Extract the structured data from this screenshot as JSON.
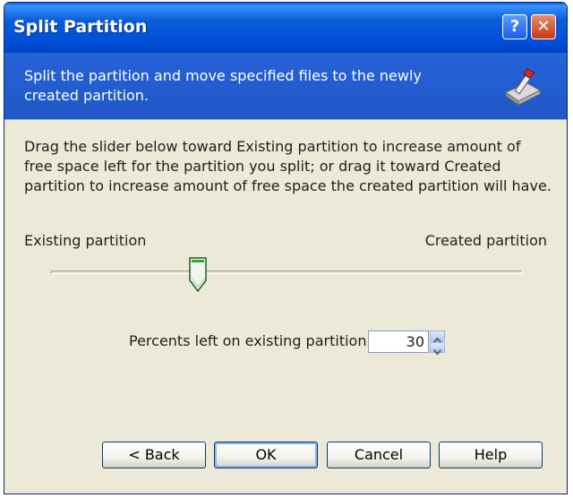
{
  "window": {
    "title": "Split Partition",
    "help_glyph": "?",
    "close_glyph": "✕"
  },
  "header": {
    "text": "Split the partition and move specified files to the newly created partition.",
    "icon": "wizard-disk-icon"
  },
  "content": {
    "description": "Drag the slider below toward Existing partition to increase amount of free space left for the partition you split; or drag it toward Created partition to increase amount of free space the created partition will have.",
    "slider": {
      "left_label": "Existing partition",
      "right_label": "Created partition",
      "value_fraction": 0.3
    },
    "spinner": {
      "label": "Percents left on existing partition:",
      "value": "30"
    }
  },
  "buttons": {
    "back": "< Back",
    "ok": "OK",
    "cancel": "Cancel",
    "help": "Help"
  },
  "colors": {
    "title_bar": "#0050d8",
    "header_band": "#2563d6",
    "dialog_bg": "#ece9d8",
    "close_button": "#c33a12"
  }
}
